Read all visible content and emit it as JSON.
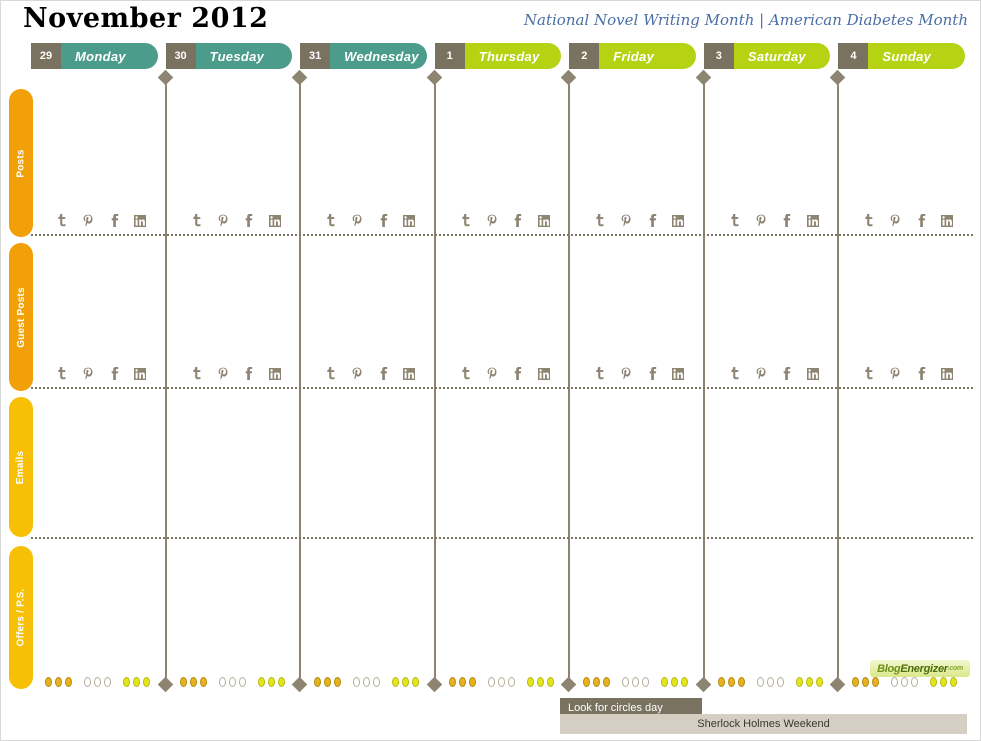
{
  "title": {
    "month": "November 2012",
    "observances": "National Novel Writing Month | American Diabetes Month"
  },
  "colors": {
    "teal": "#4c9c8b",
    "lime": "#b5d312",
    "brown": "#7a7260",
    "orange_dark": "#f2a007",
    "orange_light": "#f7c90a",
    "rule": "#7a7260",
    "script_blue": "#4a6fa5"
  },
  "days": [
    {
      "num": "29",
      "name": "Monday",
      "color": "#4c9c8b"
    },
    {
      "num": "30",
      "name": "Tuesday",
      "color": "#4c9c8b"
    },
    {
      "num": "31",
      "name": "Wednesday",
      "color": "#4c9c8b"
    },
    {
      "num": "1",
      "name": "Thursday",
      "color": "#b5d312"
    },
    {
      "num": "2",
      "name": "Friday",
      "color": "#b5d312"
    },
    {
      "num": "3",
      "name": "Saturday",
      "color": "#b5d312"
    },
    {
      "num": "4",
      "name": "Sunday",
      "color": "#b5d312"
    }
  ],
  "categories": [
    {
      "label": "Posts",
      "color": "#f2a007"
    },
    {
      "label": "Guest Posts",
      "color": "#f2a007"
    },
    {
      "label": "Emails",
      "color": "#f7c005"
    },
    {
      "label": "Offers / P.S.",
      "color": "#f7c005"
    }
  ],
  "social_icons": [
    {
      "name": "twitter-icon",
      "glyph": "t"
    },
    {
      "name": "pinterest-icon",
      "glyph": "P"
    },
    {
      "name": "facebook-icon",
      "glyph": "f"
    },
    {
      "name": "linkedin-icon",
      "glyph": "in"
    }
  ],
  "circles": {
    "pattern": [
      "gold",
      "gold",
      "gold",
      "gap",
      "white",
      "white",
      "white",
      "gap",
      "lime",
      "lime",
      "lime"
    ]
  },
  "events": [
    {
      "label": "Look for circles day",
      "style": "dark"
    },
    {
      "label": "Sherlock Holmes Weekend",
      "style": "light"
    }
  ],
  "logo": {
    "part1": "Blog",
    "part2": "Energizer",
    "suffix": ".com"
  }
}
